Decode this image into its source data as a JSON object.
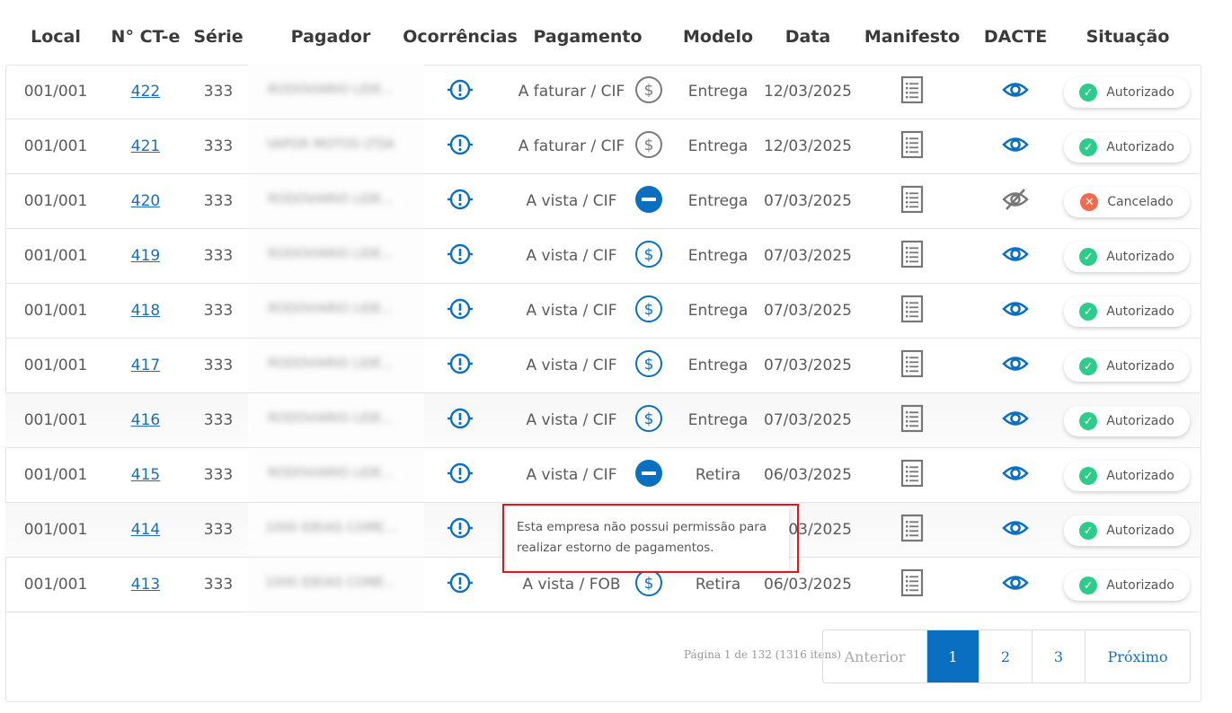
{
  "headers": {
    "local": "Local",
    "cte": "N° CT-e",
    "serie": "Série",
    "pagador": "Pagador",
    "ocorrencias": "Ocorrências",
    "pagamento": "Pagamento",
    "modelo": "Modelo",
    "data": "Data",
    "manifesto": "Manifesto",
    "dacte": "DACTE",
    "situacao": "Situação"
  },
  "rows": [
    {
      "local": "001/001",
      "cte": "422",
      "serie": "333",
      "pagador": "RODOVIARIO LIDE...",
      "pagamento": "A faturar / CIF",
      "pay_icon": "dollar-gray",
      "modelo": "Entrega",
      "data": "12/03/2025",
      "dacte": "eye",
      "situacao": "Autorizado",
      "status": "ok"
    },
    {
      "local": "001/001",
      "cte": "421",
      "serie": "333",
      "pagador": "VAPOR MOTOS LTDA",
      "pagamento": "A faturar / CIF",
      "pay_icon": "dollar-gray",
      "modelo": "Entrega",
      "data": "12/03/2025",
      "dacte": "eye",
      "situacao": "Autorizado",
      "status": "ok"
    },
    {
      "local": "001/001",
      "cte": "420",
      "serie": "333",
      "pagador": "RODOVIARIO LIDE...",
      "pagamento": "A vista / CIF",
      "pay_icon": "minus",
      "modelo": "Entrega",
      "data": "07/03/2025",
      "dacte": "eye-off",
      "situacao": "Cancelado",
      "status": "bad"
    },
    {
      "local": "001/001",
      "cte": "419",
      "serie": "333",
      "pagador": "RODOVIARIO LIDE...",
      "pagamento": "A vista / CIF",
      "pay_icon": "dollar-blue",
      "modelo": "Entrega",
      "data": "07/03/2025",
      "dacte": "eye",
      "situacao": "Autorizado",
      "status": "ok"
    },
    {
      "local": "001/001",
      "cte": "418",
      "serie": "333",
      "pagador": "RODOVIARIO LIDE...",
      "pagamento": "A vista / CIF",
      "pay_icon": "dollar-blue",
      "modelo": "Entrega",
      "data": "07/03/2025",
      "dacte": "eye",
      "situacao": "Autorizado",
      "status": "ok"
    },
    {
      "local": "001/001",
      "cte": "417",
      "serie": "333",
      "pagador": "RODOVIARIO LIDE...",
      "pagamento": "A vista / CIF",
      "pay_icon": "dollar-blue",
      "modelo": "Entrega",
      "data": "07/03/2025",
      "dacte": "eye",
      "situacao": "Autorizado",
      "status": "ok"
    },
    {
      "local": "001/001",
      "cte": "416",
      "serie": "333",
      "pagador": "RODOVIARIO LIDE...",
      "pagamento": "A vista / CIF",
      "pay_icon": "dollar-blue",
      "modelo": "Entrega",
      "data": "07/03/2025",
      "dacte": "eye",
      "situacao": "Autorizado",
      "status": "ok"
    },
    {
      "local": "001/001",
      "cte": "415",
      "serie": "333",
      "pagador": "RODOVIARIO LIDE...",
      "pagamento": "A vista / CIF",
      "pay_icon": "minus",
      "modelo": "Retira",
      "data": "06/03/2025",
      "dacte": "eye",
      "situacao": "Autorizado",
      "status": "ok"
    },
    {
      "local": "001/001",
      "cte": "414",
      "serie": "333",
      "pagador": "1000 IDEIAS COME...",
      "pagamento": "",
      "pay_icon": "none",
      "modelo": "",
      "data": "06/03/2025",
      "dacte": "eye",
      "situacao": "Autorizado",
      "status": "ok"
    },
    {
      "local": "001/001",
      "cte": "413",
      "serie": "333",
      "pagador": "1000 IDEIAS COME...",
      "pagamento": "A vista / FOB",
      "pay_icon": "dollar-blue",
      "modelo": "Retira",
      "data": "06/03/2025",
      "dacte": "eye",
      "situacao": "Autorizado",
      "status": "ok"
    }
  ],
  "tooltip": {
    "line1": "Esta empresa não possui permissão para",
    "line2": "realizar estorno de pagamentos."
  },
  "pagination": {
    "info": "Página 1 de 132 (1316 itens)",
    "prev": "Anterior",
    "pages": [
      "1",
      "2",
      "3"
    ],
    "current": "1",
    "next": "Próximo"
  },
  "colors": {
    "accent": "#0b6fc1",
    "ok": "#2ecc8a",
    "cancel": "#ef6b4f",
    "highlight": "#e3161d"
  }
}
